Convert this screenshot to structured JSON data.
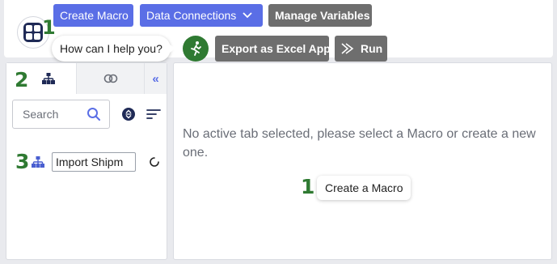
{
  "toolbar": {
    "app_icon": "apps-grid-icon",
    "step_badge": "1",
    "buttons": {
      "create_macro": "Create Macro",
      "data_connections": "Data Connections",
      "manage_variables": "Manage Variables",
      "export_excel": "Export as Excel App",
      "run": "Run"
    },
    "help_prompt": "How can I help you?",
    "assistant_icon": "running-figure-icon",
    "colors": {
      "primary": "#5a6ee6",
      "secondary": "#6e6e6e",
      "accent_green": "#2f7a32"
    }
  },
  "sidebar": {
    "step_badge": "2",
    "tabs": [
      {
        "icon": "hierarchy-icon",
        "active": true
      },
      {
        "icon": "link-rings-icon",
        "active": false
      },
      {
        "icon": "collapse-chevrons-icon",
        "label": "«"
      }
    ],
    "search": {
      "placeholder": "Search"
    },
    "tree": {
      "step_badge": "3",
      "item_value": "Import Shipm"
    }
  },
  "main": {
    "empty_message": "No active tab selected, please select a Macro or create a new one.",
    "step_badge": "1",
    "create_button": "Create a Macro"
  }
}
